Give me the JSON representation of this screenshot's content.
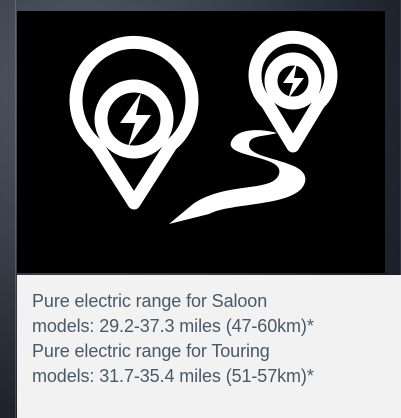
{
  "icon": {
    "name": "electric-route-icon",
    "stroke_color": "#ffffff",
    "background_color": "#000000"
  },
  "caption": {
    "saloon": {
      "line1": "Pure electric range for Saloon",
      "line2": "models: 29.2-37.3 miles (47-60km)*"
    },
    "touring": {
      "line1": "Pure electric range for Touring",
      "line2": "models: 31.7-35.4 miles (51-57km)*"
    },
    "text_color": "#4a5967",
    "background_color": "#f2f2f2"
  }
}
